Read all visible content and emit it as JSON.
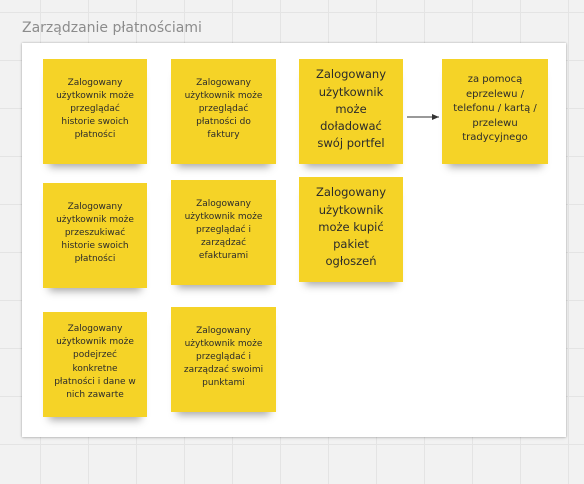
{
  "frame": {
    "title": "Zarządzanie płatnościami"
  },
  "notes": [
    {
      "id": "history-view",
      "text": "Zalogowany użytkownik może przeglądać historie swoich płatności"
    },
    {
      "id": "invoice-view",
      "text": "Zalogowany użytkownik może przeglądać płatności do faktury"
    },
    {
      "id": "wallet-topup",
      "text": "Zalogowany użytkownik może doładować swój portfel"
    },
    {
      "id": "payment-methods",
      "text": "za pomocą eprzelewu / telefonu / kartą / przelewu tradycyjnego"
    },
    {
      "id": "history-search",
      "text": "Zalogowany użytkownik może przeszukiwać historie swoich płatności"
    },
    {
      "id": "einvoices",
      "text": "Zalogowany użytkownik może przeglądać i zarządzać efakturami"
    },
    {
      "id": "buy-ad-package",
      "text": "Zalogowany użytkownik może kupić pakiet ogłoszeń"
    },
    {
      "id": "payment-details",
      "text": "Zalogowany użytkownik może podejrzeć konkretne płatności i dane w nich zawarte"
    },
    {
      "id": "points",
      "text": "Zalogowany użytkownik może przeglądać i zarządzać swoimi punktami"
    }
  ],
  "connections": [
    {
      "from": "wallet-topup",
      "to": "payment-methods",
      "style": "arrow"
    }
  ],
  "colors": {
    "sticky_note": "#f5d327",
    "frame": "#ffffff",
    "canvas": "#f2f2f2",
    "arrow": "#333333"
  }
}
